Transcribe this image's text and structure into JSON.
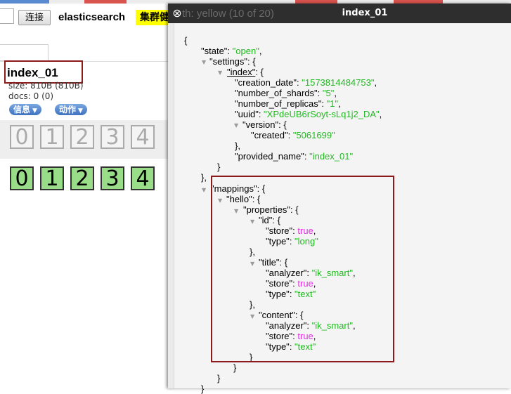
{
  "toolbar": {
    "connect_label": "连接",
    "brand": "elasticsearch",
    "health_text": "集群健"
  },
  "index_card": {
    "name": "index_01",
    "size": "size: 810B (810B)",
    "docs": "docs: 0 (0)",
    "info_button": "信息",
    "action_button": "动作",
    "unassigned_shards": [
      "0",
      "1",
      "2",
      "3",
      "4"
    ],
    "assigned_shards": [
      "0",
      "1",
      "2",
      "3",
      "4"
    ]
  },
  "modal": {
    "title": "index_01",
    "ghost_text": "th: yellow (10 of 20)"
  },
  "json_view": {
    "state_key": "\"state\"",
    "state_value": "\"open\"",
    "settings_key": "\"settings\"",
    "index_key": "\"index\"",
    "creation_date_key": "\"creation_date\"",
    "creation_date_value": "\"1573814484753\"",
    "number_of_shards_key": "\"number_of_shards\"",
    "number_of_shards_value": "\"5\"",
    "number_of_replicas_key": "\"number_of_replicas\"",
    "number_of_replicas_value": "\"1\"",
    "uuid_key": "\"uuid\"",
    "uuid_value": "\"XPdeUB6rSoyt-sLq1j2_DA\"",
    "version_key": "\"version\"",
    "created_key": "\"created\"",
    "created_value": "\"5061699\"",
    "provided_name_key": "\"provided_name\"",
    "provided_name_value": "\"index_01\"",
    "mappings_key": "\"mappings\"",
    "hello_key": "\"hello\"",
    "properties_key": "\"properties\"",
    "id_key": "\"id\"",
    "id_store_key": "\"store\"",
    "id_store_value": "true",
    "id_type_key": "\"type\"",
    "id_type_value": "\"long\"",
    "title_key": "\"title\"",
    "title_analyzer_key": "\"analyzer\"",
    "title_analyzer_value": "\"ik_smart\"",
    "title_store_key": "\"store\"",
    "title_store_value": "true",
    "title_type_key": "\"type\"",
    "title_type_value": "\"text\"",
    "content_key": "\"content\"",
    "content_analyzer_key": "\"analyzer\"",
    "content_analyzer_value": "\"ik_smart\"",
    "content_store_key": "\"store\"",
    "content_store_value": "true",
    "content_type_key": "\"type\"",
    "content_type_value": "\"text\""
  },
  "colors": {
    "string": "#22b922",
    "boolean": "#e030e0",
    "highlight_box": "#8b1a1a",
    "health_yellow": "#ffff00",
    "assigned_shard": "#99dd88"
  }
}
